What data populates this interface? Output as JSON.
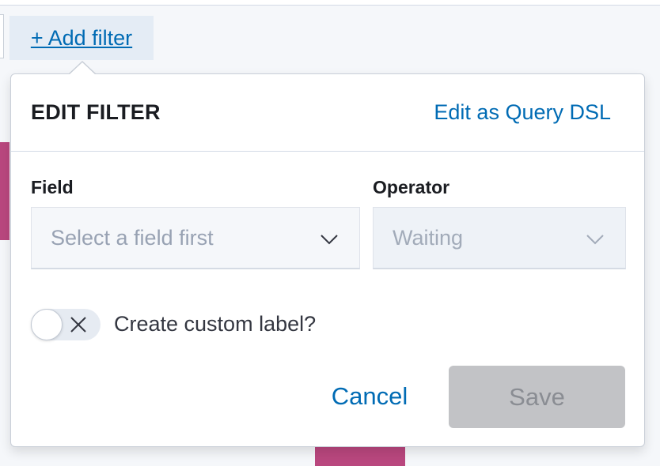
{
  "add_filter": {
    "label": "+ Add filter"
  },
  "popover": {
    "title": "EDIT FILTER",
    "query_dsl_link": "Edit as Query DSL"
  },
  "field": {
    "label": "Field",
    "placeholder": "Select a field first",
    "icon": "chevron-down-icon"
  },
  "operator": {
    "label": "Operator",
    "value": "Waiting",
    "icon": "chevron-down-icon",
    "disabled": true
  },
  "custom_label": {
    "toggle_on": false,
    "text": "Create custom label?"
  },
  "actions": {
    "cancel": "Cancel",
    "save": "Save",
    "save_disabled": true
  },
  "colors": {
    "accent": "#006bb4",
    "decoration": "#b9477e",
    "save_disabled_bg": "#c2c3c6"
  }
}
